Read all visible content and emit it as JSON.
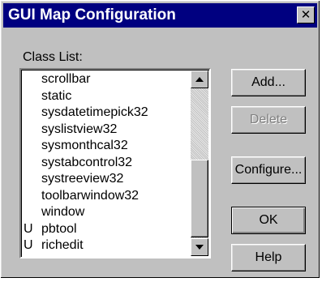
{
  "window": {
    "title": "GUI Map Configuration",
    "close_glyph": "✕"
  },
  "class_list": {
    "label": "Class List:",
    "items": [
      {
        "flag": "",
        "name": "scrollbar"
      },
      {
        "flag": "",
        "name": "static"
      },
      {
        "flag": "",
        "name": "sysdatetimepick32"
      },
      {
        "flag": "",
        "name": "syslistview32"
      },
      {
        "flag": "",
        "name": "sysmonthcal32"
      },
      {
        "flag": "",
        "name": "systabcontrol32"
      },
      {
        "flag": "",
        "name": "systreeview32"
      },
      {
        "flag": "",
        "name": "toolbarwindow32"
      },
      {
        "flag": "",
        "name": "window"
      },
      {
        "flag": "U",
        "name": "pbtool"
      },
      {
        "flag": "U",
        "name": "richedit"
      }
    ]
  },
  "buttons": {
    "add": "Add...",
    "delete": "Delete",
    "configure": "Configure...",
    "ok": "OK",
    "help": "Help"
  },
  "colors": {
    "title_bar": "#000080",
    "dialog_face": "#c0c0c0",
    "disabled_text": "#808080"
  }
}
